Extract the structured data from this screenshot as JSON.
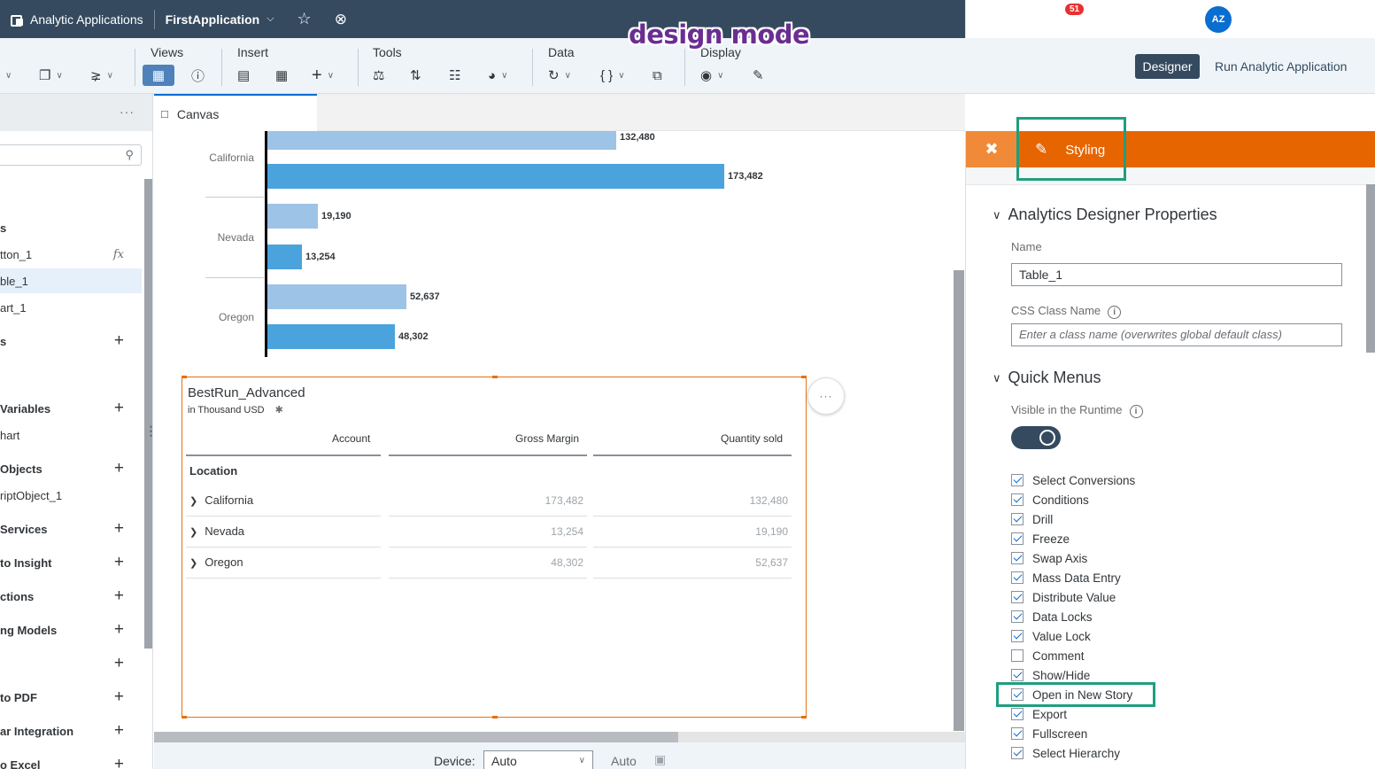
{
  "shell": {
    "app_title": "Analytic Applications",
    "file_name": "FirstApplication",
    "notification_count": "51",
    "avatar_initials": "AZ"
  },
  "annotation": "design mode",
  "toolbar": {
    "views_label": "Views",
    "insert_label": "Insert",
    "tools_label": "Tools",
    "data_label": "Data",
    "display_label": "Display",
    "designer_button": "Designer",
    "run_button": "Run Analytic Application"
  },
  "outline": {
    "items": [
      {
        "label": "s",
        "bold": true
      },
      {
        "label": "tton_1"
      },
      {
        "label": "ble_1"
      },
      {
        "label": "art_1"
      },
      {
        "label": "s",
        "bold": true
      },
      {
        "label": "Variables",
        "bold": true
      },
      {
        "label": "hart"
      },
      {
        "label": "Objects",
        "bold": true
      },
      {
        "label": "riptObject_1"
      },
      {
        "label": "Services",
        "bold": true
      },
      {
        "label": "to Insight",
        "bold": true
      },
      {
        "label": "ctions",
        "bold": true
      },
      {
        "label": "ng Models",
        "bold": true
      },
      {
        "label": "",
        "bold": true
      },
      {
        "label": "to PDF",
        "bold": true
      },
      {
        "label": "ar Integration",
        "bold": true
      },
      {
        "label": "o Excel",
        "bold": true
      }
    ]
  },
  "canvas_tab": "Canvas",
  "chart_data": {
    "type": "bar",
    "orientation": "horizontal",
    "categories": [
      "California",
      "Nevada",
      "Oregon"
    ],
    "series": [
      {
        "values": [
          132480,
          19190,
          52637
        ],
        "color": "#9dc3e6"
      },
      {
        "values": [
          173482,
          13254,
          48302
        ],
        "color": "#4aa3dc"
      }
    ],
    "labels": [
      "132,480",
      "173,482",
      "19,190",
      "13,254",
      "52,637",
      "48,302"
    ]
  },
  "table": {
    "title": "BestRun_Advanced",
    "subtitle": "in Thousand USD",
    "headers": [
      "Account",
      "Gross Margin",
      "Quantity sold"
    ],
    "row_header": "Location",
    "rows": [
      {
        "label": "California",
        "gross_margin": "173,482",
        "quantity": "132,480"
      },
      {
        "label": "Nevada",
        "gross_margin": "13,254",
        "quantity": "19,190"
      },
      {
        "label": "Oregon",
        "gross_margin": "48,302",
        "quantity": "52,637"
      }
    ]
  },
  "footer": {
    "device_label": "Device:",
    "device_value": "Auto",
    "auto_label": "Auto"
  },
  "panel": {
    "styling_tab": "Styling",
    "section1": "Analytics Designer Properties",
    "name_label": "Name",
    "name_value": "Table_1",
    "css_label": "CSS Class Name",
    "css_placeholder": "Enter a class name (overwrites global default class)",
    "section2": "Quick Menus",
    "visible_label": "Visible in the Runtime",
    "menus": [
      {
        "label": "Select Conversions",
        "checked": true
      },
      {
        "label": "Conditions",
        "checked": true
      },
      {
        "label": "Drill",
        "checked": true
      },
      {
        "label": "Freeze",
        "checked": true
      },
      {
        "label": "Swap Axis",
        "checked": true
      },
      {
        "label": "Mass Data Entry",
        "checked": true
      },
      {
        "label": "Distribute Value",
        "checked": true
      },
      {
        "label": "Data Locks",
        "checked": true
      },
      {
        "label": "Value Lock",
        "checked": true
      },
      {
        "label": "Comment",
        "checked": false
      },
      {
        "label": "Show/Hide",
        "checked": true
      },
      {
        "label": "Open in New Story",
        "checked": true
      },
      {
        "label": "Export",
        "checked": true
      },
      {
        "label": "Fullscreen",
        "checked": true
      },
      {
        "label": "Select Hierarchy",
        "checked": true
      }
    ]
  }
}
